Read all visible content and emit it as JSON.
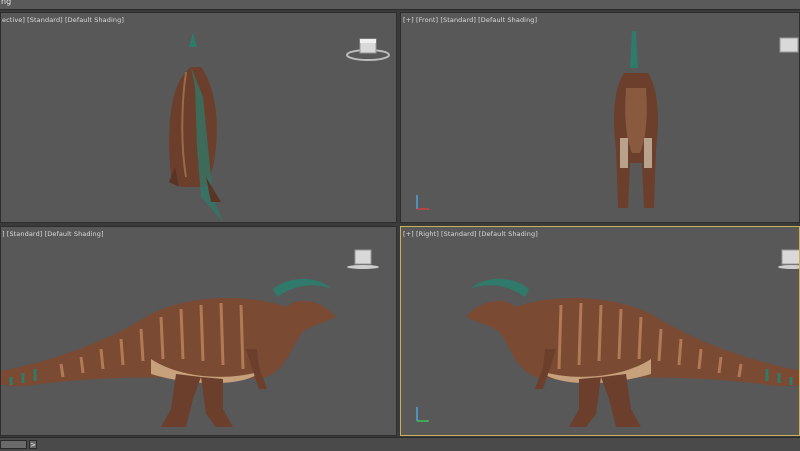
{
  "window": {
    "title_fragment": "ng"
  },
  "viewports": {
    "perspective": {
      "label": "ective] [Standard] [Default Shading]"
    },
    "front": {
      "label": "[+] [Front] [Standard] [Default Shading]"
    },
    "left": {
      "label": "] [Standard] [Default Shading]"
    },
    "right": {
      "label": "[+] [Right] [Standard] [Default Shading]"
    }
  },
  "timeline": {
    "frame": "",
    "next_label": ">"
  },
  "colors": {
    "viewport_bg": "#585858",
    "active_border": "#c9b15a",
    "skin_body": "#7a4a33",
    "skin_stripe": "#b07a55",
    "crest": "#2f7a6a",
    "belly": "#c7a17c"
  },
  "icons": [
    "viewcube-icon",
    "axis-gizmo-icon"
  ]
}
